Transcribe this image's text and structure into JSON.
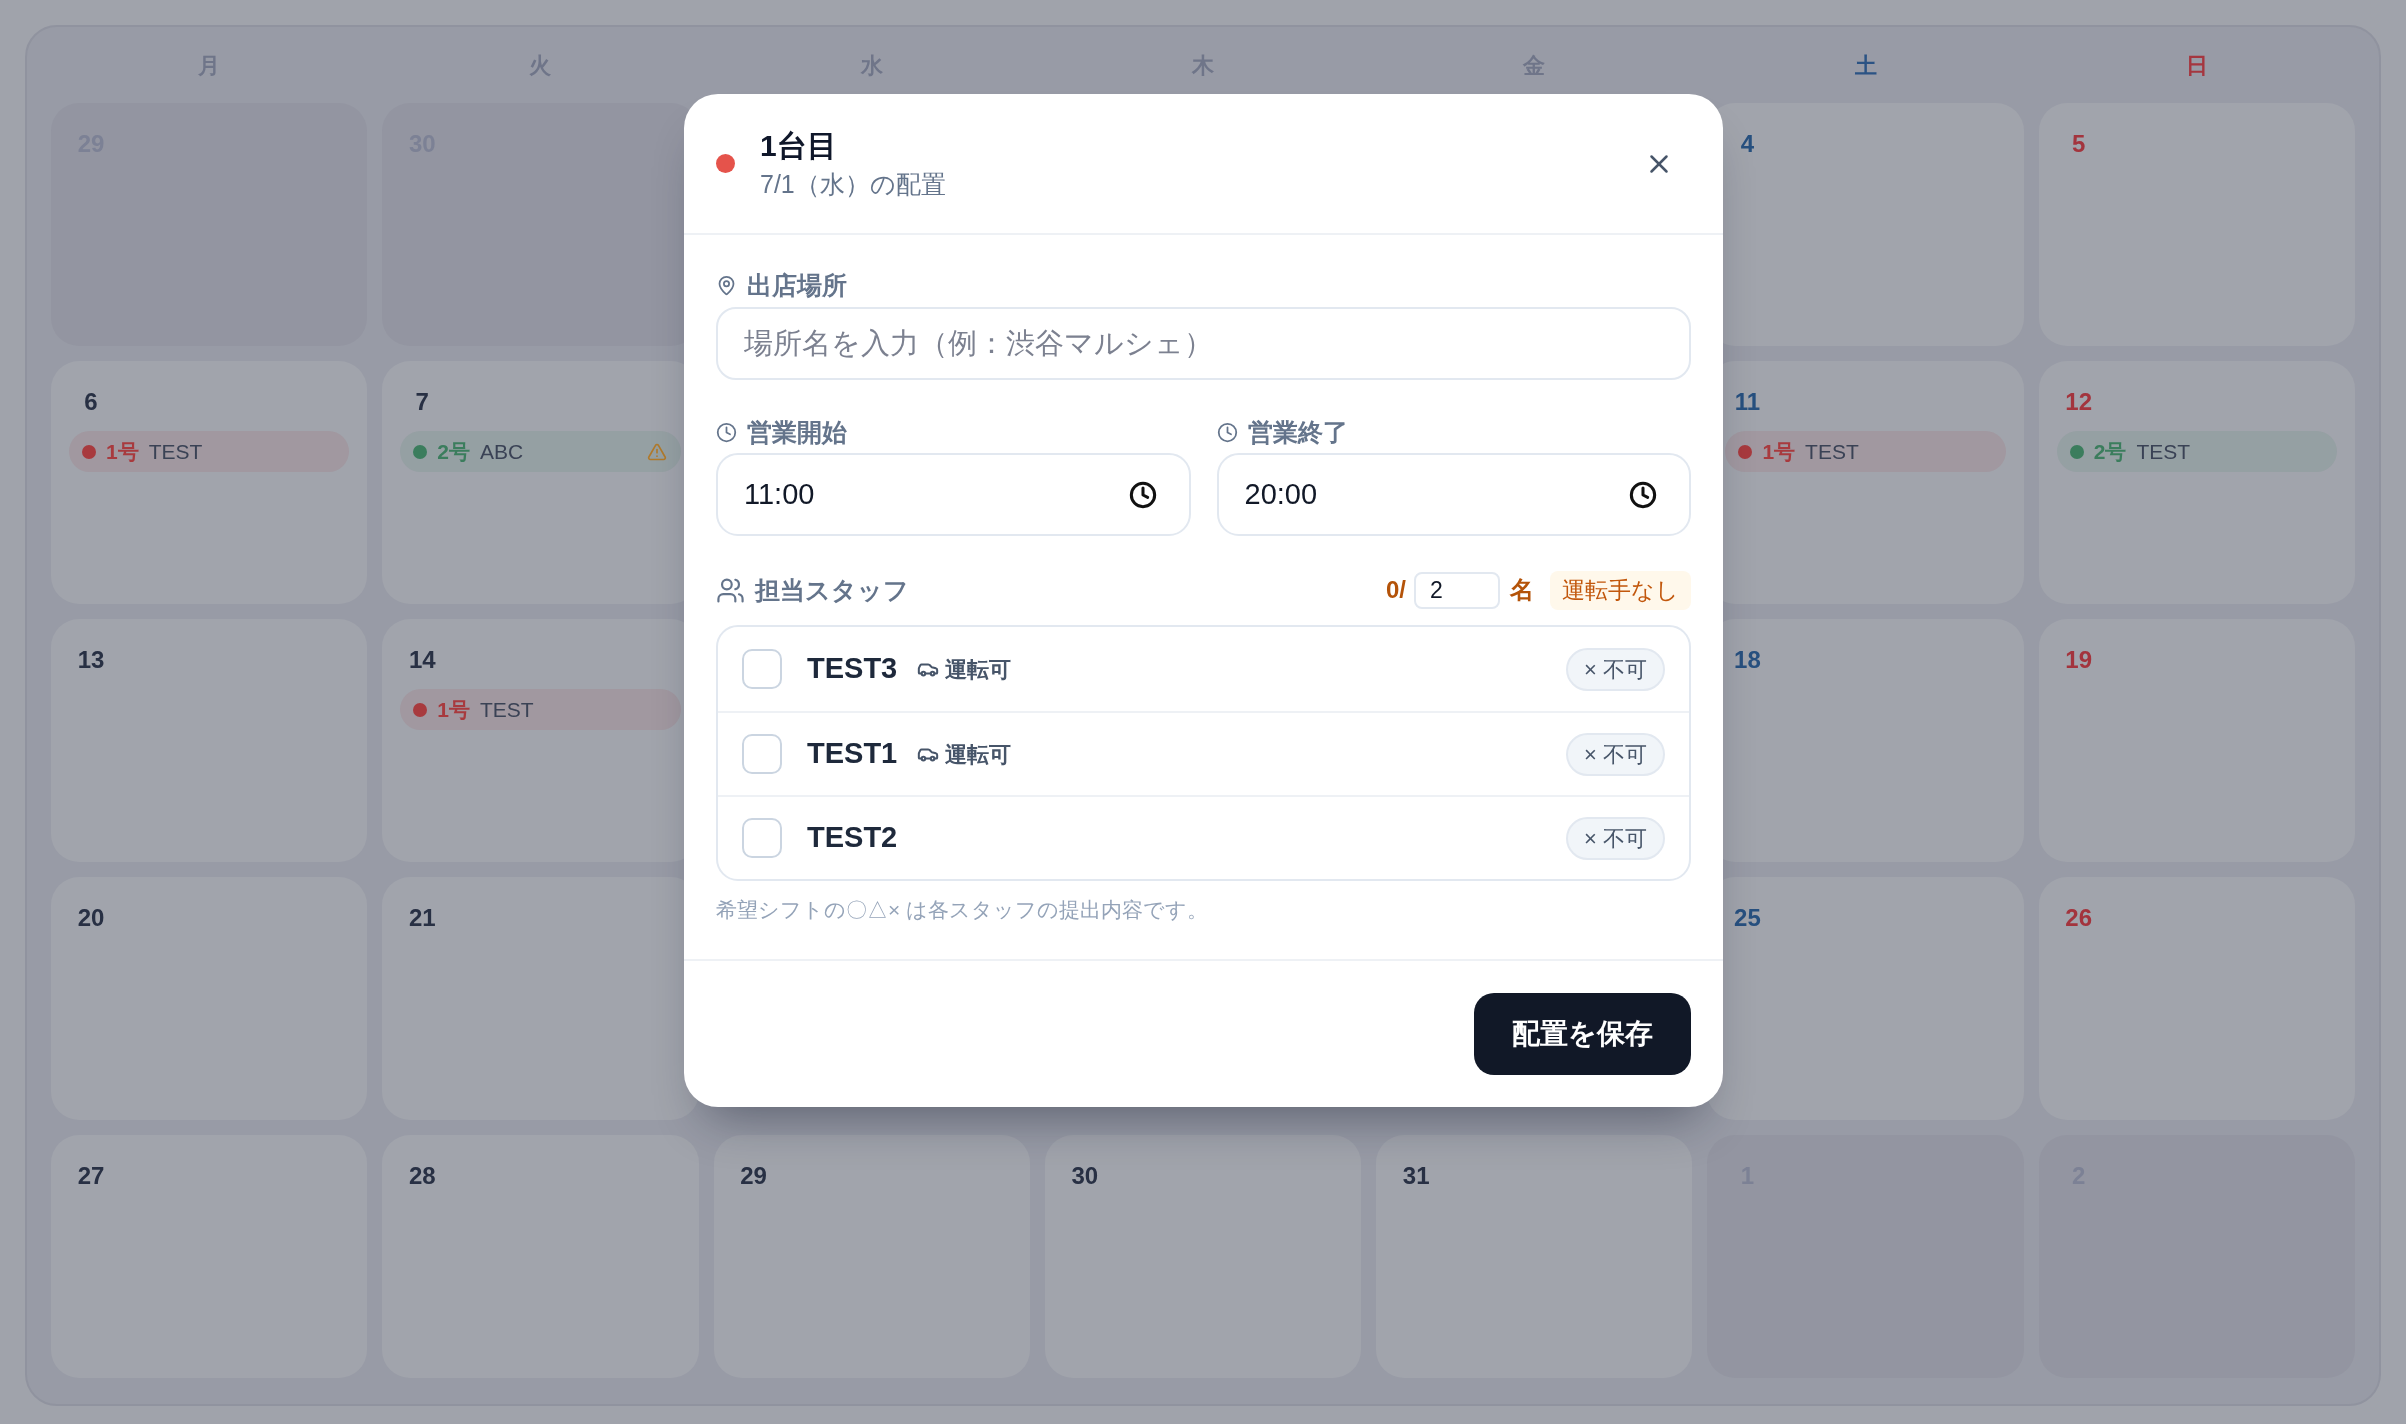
{
  "calendar": {
    "weekdays": [
      {
        "label": "月",
        "kind": "weekday"
      },
      {
        "label": "火",
        "kind": "weekday"
      },
      {
        "label": "水",
        "kind": "weekday"
      },
      {
        "label": "木",
        "kind": "weekday"
      },
      {
        "label": "金",
        "kind": "weekday"
      },
      {
        "label": "土",
        "kind": "saturday"
      },
      {
        "label": "日",
        "kind": "sunday"
      }
    ],
    "weeks": [
      [
        {
          "day": "29",
          "kind": "other_month"
        },
        {
          "day": "30",
          "kind": "other_month"
        },
        {
          "day": "4",
          "kind": "saturday"
        },
        {
          "day": "5",
          "kind": "sunday"
        }
      ],
      [
        {
          "day": "6",
          "kind": "current",
          "events": [
            {
              "vehicle": "1号",
              "name": "TEST",
              "color": "#a83a3e",
              "warning": false
            }
          ]
        },
        {
          "day": "7",
          "kind": "current",
          "events": [
            {
              "vehicle": "2号",
              "name": "ABC",
              "color": "#3b7d5d",
              "warning": true
            }
          ]
        },
        {
          "day": "11",
          "kind": "saturday",
          "events": [
            {
              "vehicle": "1号",
              "name": "TEST",
              "color": "#a83a3e",
              "warning": false
            }
          ]
        },
        {
          "day": "12",
          "kind": "sunday",
          "events": [
            {
              "vehicle": "2号",
              "name": "TEST",
              "color": "#3b7d5d",
              "warning": false
            }
          ]
        }
      ],
      [
        {
          "day": "13",
          "kind": "current"
        },
        {
          "day": "14",
          "kind": "current",
          "events": [
            {
              "vehicle": "1号",
              "name": "TEST",
              "color": "#a83a3e",
              "warning": false
            }
          ]
        },
        {
          "day": "18",
          "kind": "saturday"
        },
        {
          "day": "19",
          "kind": "sunday"
        }
      ],
      [
        {
          "day": "20",
          "kind": "current"
        },
        {
          "day": "21",
          "kind": "current"
        },
        {
          "day": "25",
          "kind": "saturday"
        },
        {
          "day": "26",
          "kind": "sunday"
        }
      ],
      [
        {
          "day": "27",
          "kind": "current"
        },
        {
          "day": "28",
          "kind": "current"
        },
        {
          "day": "29",
          "kind": "current"
        },
        {
          "day": "30",
          "kind": "current"
        },
        {
          "day": "31",
          "kind": "current"
        },
        {
          "day": "1",
          "kind": "other_month"
        },
        {
          "day": "2",
          "kind": "other_month"
        }
      ]
    ]
  },
  "dialog": {
    "title": "1台目",
    "subtitle": "7/1（水）の配置",
    "location": {
      "label": "出店場所",
      "placeholder": "場所名を入力（例：渋谷マルシェ）"
    },
    "hours": [
      {
        "label": "営業開始",
        "value": "11:00"
      },
      {
        "label": "営業終了",
        "value": "20:00"
      }
    ],
    "staff": {
      "label": "担当スタッフ",
      "count": "0/",
      "required": "2",
      "unit": "名",
      "badge": "運転手なし",
      "members": [
        {
          "name": "TEST3",
          "checked": false,
          "driver": "運転可",
          "availability": "× 不可"
        },
        {
          "name": "TEST1",
          "checked": false,
          "driver": "運転可",
          "availability": "× 不可"
        },
        {
          "name": "TEST2",
          "checked": false,
          "availability": "× 不可"
        }
      ]
    },
    "note": "希望シフトの〇△× は各スタッフの提出内容です。",
    "save_button": "配置を保存"
  }
}
